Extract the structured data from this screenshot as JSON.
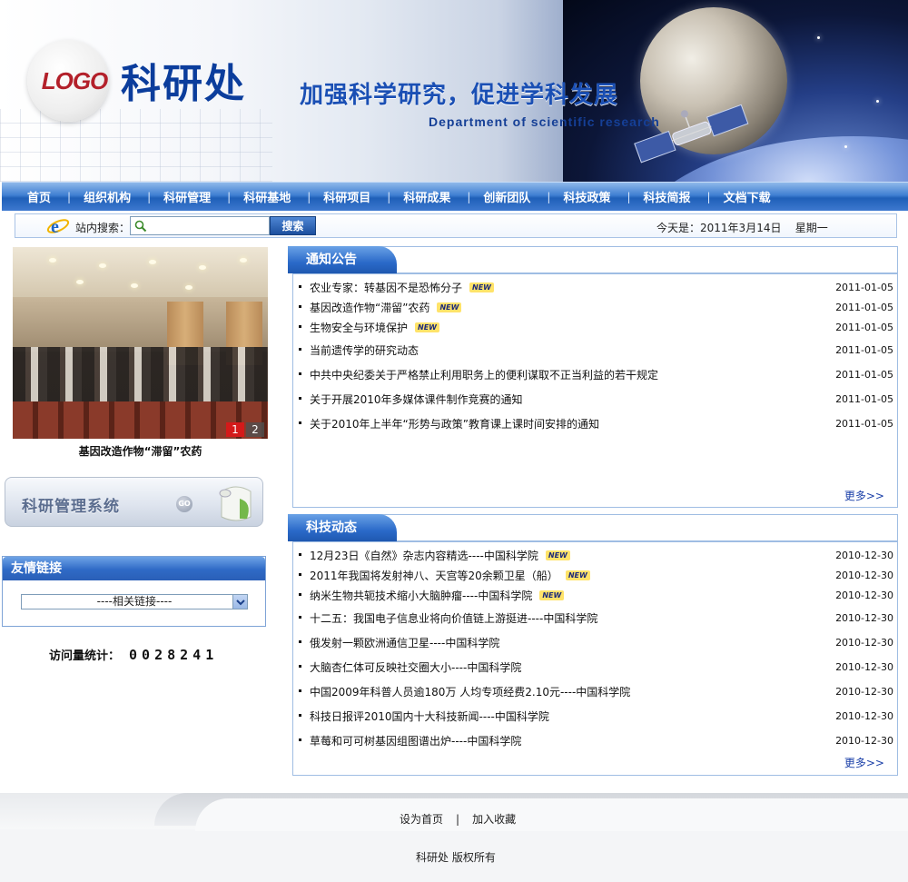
{
  "header": {
    "logo_text": "LOGO",
    "site_title": "科研处",
    "slogan": "加强科学研究，促进学科发展",
    "slogan_en": "Department of scientific research"
  },
  "nav": {
    "items": [
      "首页",
      "组织机构",
      "科研管理",
      "科研基地",
      "科研项目",
      "科研成果",
      "创新团队",
      "科技政策",
      "科技简报",
      "文档下载"
    ],
    "separator": "|"
  },
  "search": {
    "label": "站内搜索：",
    "input_value": "",
    "button_label": "搜索",
    "date_label": "今天是：",
    "date_value": "2011年3月14日",
    "weekday": "星期一"
  },
  "slideshow": {
    "caption": "基因改造作物“滞留”农药",
    "pages": [
      "1",
      "2"
    ],
    "active_page": "1"
  },
  "system_banner": {
    "title": "科研管理系统",
    "go_label": "GO"
  },
  "friend_links": {
    "heading": "友情链接",
    "select_value": "----相关链接----"
  },
  "visits": {
    "label": "访问量统计：",
    "count": "0028241"
  },
  "notices": {
    "heading": "通知公告",
    "more": "更多>>",
    "items": [
      {
        "title": "农业专家：转基因不是恐怖分子",
        "new": "NEW",
        "date": "2011-01-05"
      },
      {
        "title": "基因改造作物“滞留”农药",
        "new": "NEW",
        "date": "2011-01-05"
      },
      {
        "title": "生物安全与环境保护",
        "new": "NEW",
        "date": "2011-01-05"
      },
      {
        "title": "当前遗传学的研究动态",
        "new": "",
        "date": "2011-01-05"
      },
      {
        "title": "中共中央纪委关于严格禁止利用职务上的便利谋取不正当利益的若干规定",
        "new": "",
        "date": "2011-01-05"
      },
      {
        "title": "关于开展2010年多媒体课件制作竞赛的通知",
        "new": "",
        "date": "2011-01-05"
      },
      {
        "title": "关于2010年上半年“形势与政策”教育课上课时间安排的通知",
        "new": "",
        "date": "2011-01-05"
      }
    ]
  },
  "tech_news": {
    "heading": "科技动态",
    "more": "更多>>",
    "items": [
      {
        "title": "12月23日《自然》杂志内容精选----中国科学院",
        "new": "NEW",
        "date": "2010-12-30"
      },
      {
        "title": "2011年我国将发射神八、天宫等20余颗卫星（船）",
        "new": "NEW",
        "date": "2010-12-30"
      },
      {
        "title": "纳米生物共轭技术缩小大脑肿瘤----中国科学院",
        "new": "NEW",
        "date": "2010-12-30"
      },
      {
        "title": "十二五：我国电子信息业将向价值链上游挺进----中国科学院",
        "new": "",
        "date": "2010-12-30"
      },
      {
        "title": "俄发射一颗欧洲通信卫星----中国科学院",
        "new": "",
        "date": "2010-12-30"
      },
      {
        "title": "大脑杏仁体可反映社交圈大小----中国科学院",
        "new": "",
        "date": "2010-12-30"
      },
      {
        "title": "中国2009年科普人员逾180万 人均专项经费2.10元----中国科学院",
        "new": "",
        "date": "2010-12-30"
      },
      {
        "title": "科技日报评2010国内十大科技新闻----中国科学院",
        "new": "",
        "date": "2010-12-30"
      },
      {
        "title": "草莓和可可树基因组图谱出炉----中国科学院",
        "new": "",
        "date": "2010-12-30"
      }
    ]
  },
  "footer": {
    "set_home": "设为首页",
    "separator": "|",
    "add_favorite": "加入收藏",
    "copyright": "科研处  版权所有"
  }
}
